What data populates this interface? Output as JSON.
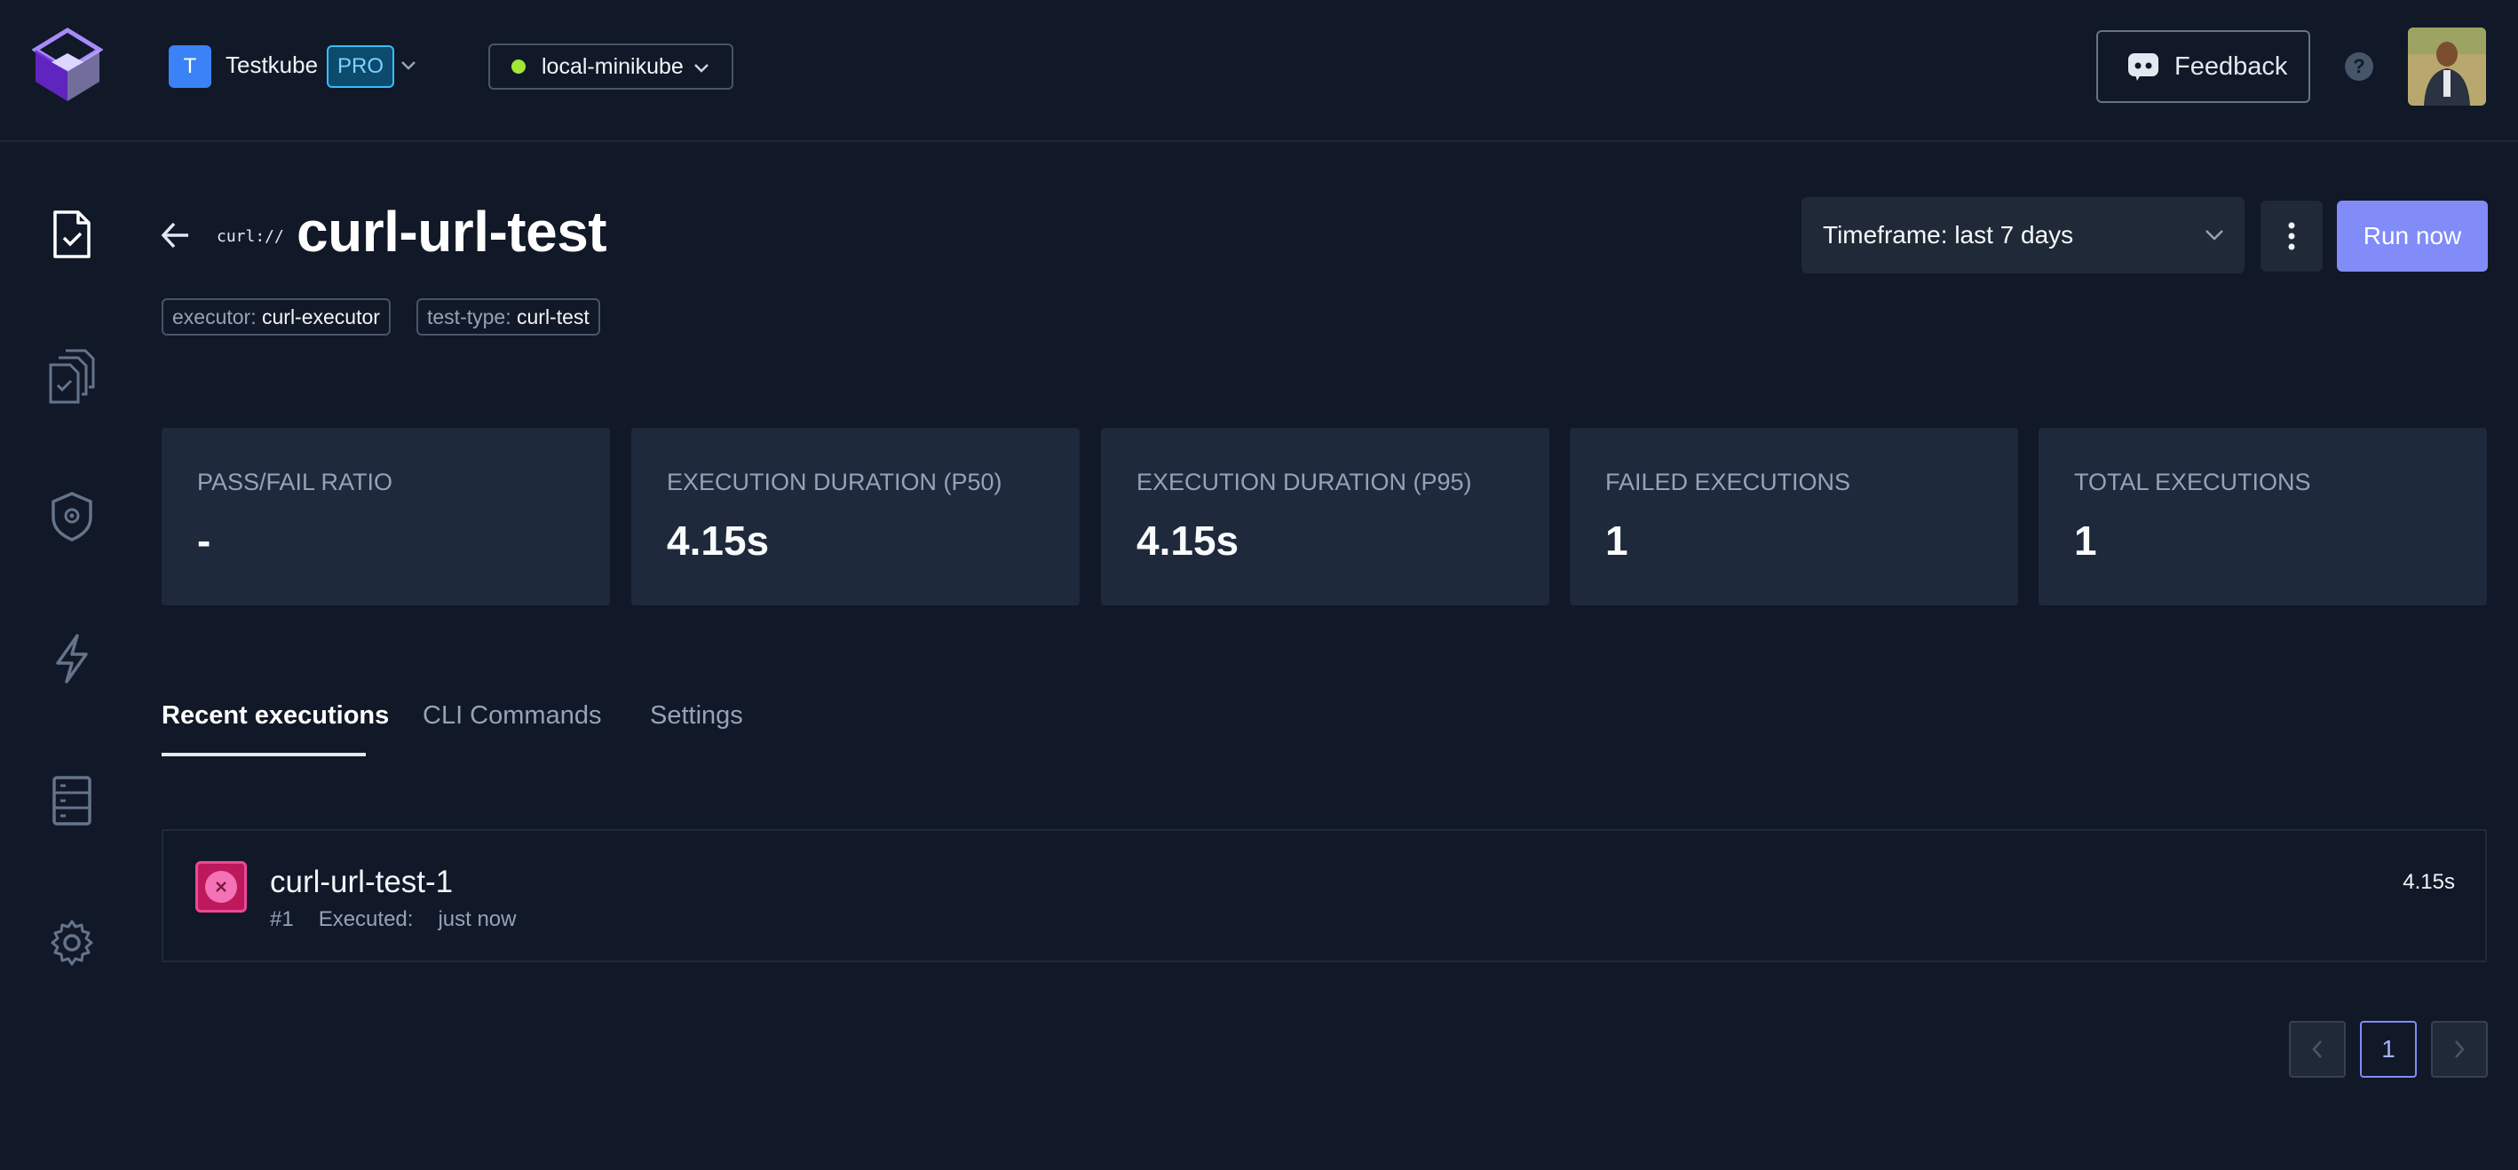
{
  "topbar": {
    "org": {
      "initial": "T",
      "name": "Testkube",
      "plan_badge": "PRO"
    },
    "environment": {
      "name": "local-minikube",
      "status_color": "#a3e635"
    },
    "feedback_label": "Feedback",
    "help_label": "?"
  },
  "sidebar": {
    "items": [
      {
        "icon": "test-file-icon",
        "active": true
      },
      {
        "icon": "test-suites-icon",
        "active": false
      },
      {
        "icon": "executors-icon",
        "active": false
      },
      {
        "icon": "triggers-icon",
        "active": false
      },
      {
        "icon": "sources-icon",
        "active": false
      },
      {
        "icon": "settings-icon",
        "active": false
      }
    ]
  },
  "header": {
    "curl_logo": "curl://",
    "title": "curl-url-test",
    "labels": [
      {
        "key": "executor:",
        "value": "curl-executor"
      },
      {
        "key": "test-type:",
        "value": "curl-test"
      }
    ],
    "timeframe": "Timeframe: last 7 days",
    "run_label": "Run now"
  },
  "metrics": [
    {
      "label": "PASS/FAIL RATIO",
      "value": "-"
    },
    {
      "label": "EXECUTION DURATION (P50)",
      "value": "4.15s"
    },
    {
      "label": "EXECUTION DURATION (P95)",
      "value": "4.15s"
    },
    {
      "label": "FAILED EXECUTIONS",
      "value": "1"
    },
    {
      "label": "TOTAL EXECUTIONS",
      "value": "1"
    }
  ],
  "tabs": [
    {
      "label": "Recent executions",
      "active": true
    },
    {
      "label": "CLI Commands",
      "active": false
    },
    {
      "label": "Settings",
      "active": false
    }
  ],
  "executions": [
    {
      "name": "curl-url-test-1",
      "number": "#1",
      "executed_label": "Executed:",
      "executed_value": "just now",
      "duration": "4.15s",
      "status": "failed"
    }
  ],
  "pagination": {
    "current_page": "1"
  },
  "colors": {
    "background": "#111827",
    "accent": "#818cf8",
    "failed": "#ec4899"
  }
}
